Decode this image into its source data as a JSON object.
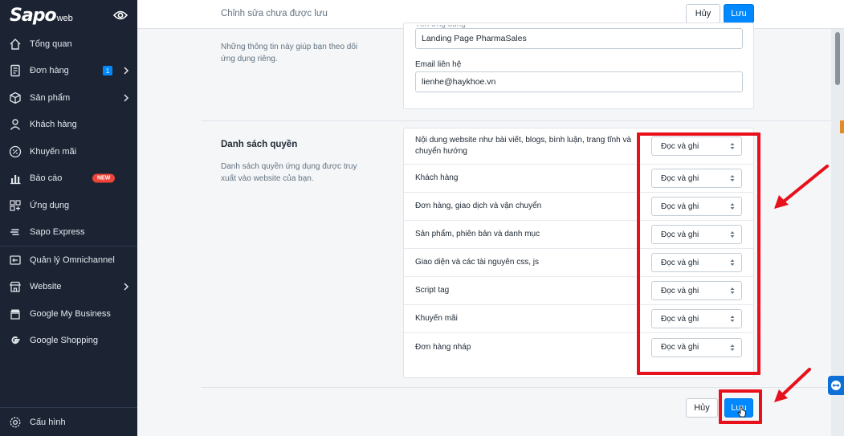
{
  "sidebar": {
    "logo_main": "Sapo",
    "logo_sub": "web",
    "items": [
      {
        "label": "Tổng quan",
        "icon": "home-icon"
      },
      {
        "label": "Đơn hàng",
        "icon": "order-icon",
        "badge": "1",
        "chevron": true
      },
      {
        "label": "Sản phẩm",
        "icon": "box-icon",
        "chevron": true
      },
      {
        "label": "Khách hàng",
        "icon": "user-icon"
      },
      {
        "label": "Khuyến mãi",
        "icon": "percent-icon"
      },
      {
        "label": "Báo cáo",
        "icon": "chart-icon",
        "badge_new": "NEW"
      },
      {
        "label": "Ứng dụng",
        "icon": "apps-icon"
      },
      {
        "label": "Sapo Express",
        "icon": "express-icon"
      },
      {
        "label": "Quản lý Omnichannel",
        "icon": "omnichannel-icon"
      },
      {
        "label": "Website",
        "icon": "store-icon",
        "chevron": true
      },
      {
        "label": "Google My Business",
        "icon": "gmb-icon"
      },
      {
        "label": "Google Shopping",
        "icon": "google-icon"
      }
    ],
    "settings_label": "Cấu hình"
  },
  "topbar": {
    "title": "Chỉnh sửa chưa được lưu",
    "cancel_label": "Hủy",
    "save_label": "Lưu"
  },
  "app_info": {
    "desc": "Những thông tin này giúp bạn theo dõi ứng dụng riêng.",
    "name_label": "Tên ứng dụng",
    "name_value": "Landing Page PharmaSales",
    "email_label": "Email liên hệ",
    "email_value": "lienhe@haykhoe.vn"
  },
  "permissions": {
    "title": "Danh sách quyền",
    "desc": "Danh sách quyền ứng dụng được truy xuất vào website của bạn.",
    "rows": [
      {
        "label": "Nội dung website như bài viết, blogs, bình luận, trang tĩnh và chuyển hướng",
        "value": "Đọc và ghi"
      },
      {
        "label": "Khách hàng",
        "value": "Đọc và ghi"
      },
      {
        "label": "Đơn hàng, giao dịch và vận chuyển",
        "value": "Đọc và ghi"
      },
      {
        "label": "Sản phẩm, phiên bản và danh mục",
        "value": "Đọc và ghi"
      },
      {
        "label": "Giao diện và các tài nguyên css, js",
        "value": "Đọc và ghi"
      },
      {
        "label": "Script tag",
        "value": "Đọc và ghi"
      },
      {
        "label": "Khuyến mãi",
        "value": "Đọc và ghi"
      },
      {
        "label": "Đơn hàng nháp",
        "value": "Đọc và ghi"
      }
    ]
  },
  "footer": {
    "cancel_label": "Hủy",
    "save_label": "Lưu"
  },
  "colors": {
    "sidebar_bg": "#1c2434",
    "accent": "#0088ff",
    "annotation_red": "#e8101b"
  }
}
